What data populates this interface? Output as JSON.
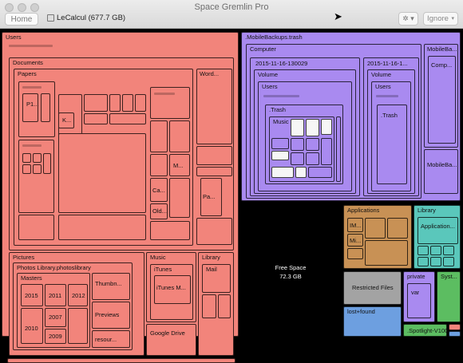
{
  "window": {
    "title": "Space Gremlin Pro",
    "home_label": "Home",
    "disk_label": "LeCalcul (677.7 GB)",
    "ignore_label": "Ignore"
  },
  "free_space": {
    "label": "Free Space",
    "size": "72.3 GB"
  },
  "colors": {
    "users": "#f2847b",
    "backups": "#a98af0",
    "library": "#5ac7bb",
    "applications": "#c89155",
    "restricted": "#a3a3a3",
    "lost_found": "#6d9fe0",
    "private": "#e184ee",
    "system": "#5cbd61"
  },
  "blocks": {
    "users": "Users",
    "documents": "Documents",
    "papers": "Papers",
    "word": "Word...",
    "p1": "P1...",
    "k": "K...",
    "m": "M...",
    "ca": "Ca...",
    "old": "Old...",
    "pa": "Pa...",
    "pictures": "Pictures",
    "photos_library": "Photos Library.photoslibrary",
    "masters": "Masters",
    "y2015": "2015",
    "y2011": "2011",
    "y2012": "2012",
    "y2007": "2007",
    "y2010": "2010",
    "y2009": "2009",
    "thumbn": "Thumbn...",
    "previews": "Previews",
    "resour": "resour...",
    "music": "Music",
    "itunes": "iTunes",
    "itunes_m": "iTunes M...",
    "library_user": "Library",
    "mail": "Mail",
    "google_drive": "Google Drive",
    "mobilebackups": ".MobileBackups.trash",
    "computer": "Computer",
    "snap1": "2015-11-16-130029",
    "snap2": "2015-11-16-1...",
    "volume1": "Volume",
    "volume2": "Volume",
    "users_b1": "Users",
    "users_b2": "Users",
    "trash1": ".Trash",
    "trash2": ".Trash",
    "music_b": "Music",
    "mobileba": "MobileBa...",
    "comp": "Comp...",
    "mobileba2": "MobileBa...",
    "applications": "Applications",
    "im": "IM...",
    "mi": "Mi...",
    "library": "Library",
    "application_dots": "Application...",
    "restricted": "Restricted Files",
    "private": "private",
    "var": "var",
    "sys": "Syst...",
    "lost_found": "lost+found",
    "spotlight": ".Spotlight-V100"
  }
}
